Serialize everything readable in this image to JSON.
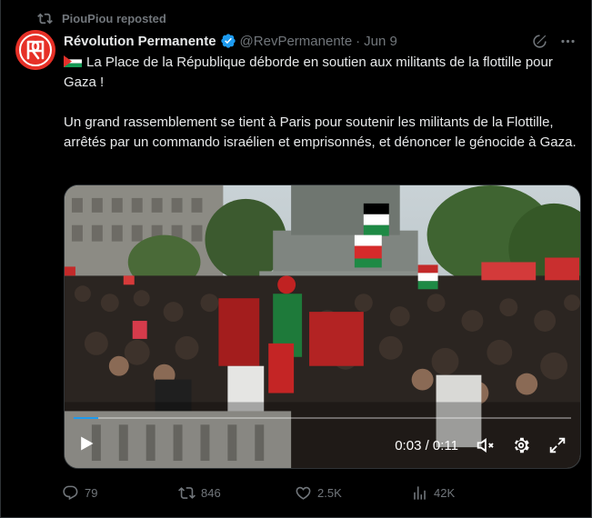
{
  "repost_banner": {
    "text": "PiouPiou reposted"
  },
  "author": {
    "name": "Révolution Permanente",
    "handle": "@RevPermanente",
    "separator": "·",
    "date": "Jun 9"
  },
  "tweet": {
    "line1": "La Place de la République déborde en soutien aux militants de la flottille pour Gaza !",
    "line2": "Un grand rassemblement se tient à Paris pour soutenir les militants de la Flottille, arrêtés par un commando israélien et emprisonnés, et dénoncer le génocide à Gaza."
  },
  "video": {
    "time": "0:03 / 0:11",
    "progress": 0.05
  },
  "actions": {
    "replies": "79",
    "reposts": "846",
    "likes": "2.5K",
    "views": "42K"
  },
  "colors": {
    "background": "#000000",
    "text": "#e7e9ea",
    "muted": "#71767b",
    "accent": "#1d9bf0",
    "avatar_red": "#e63027"
  }
}
